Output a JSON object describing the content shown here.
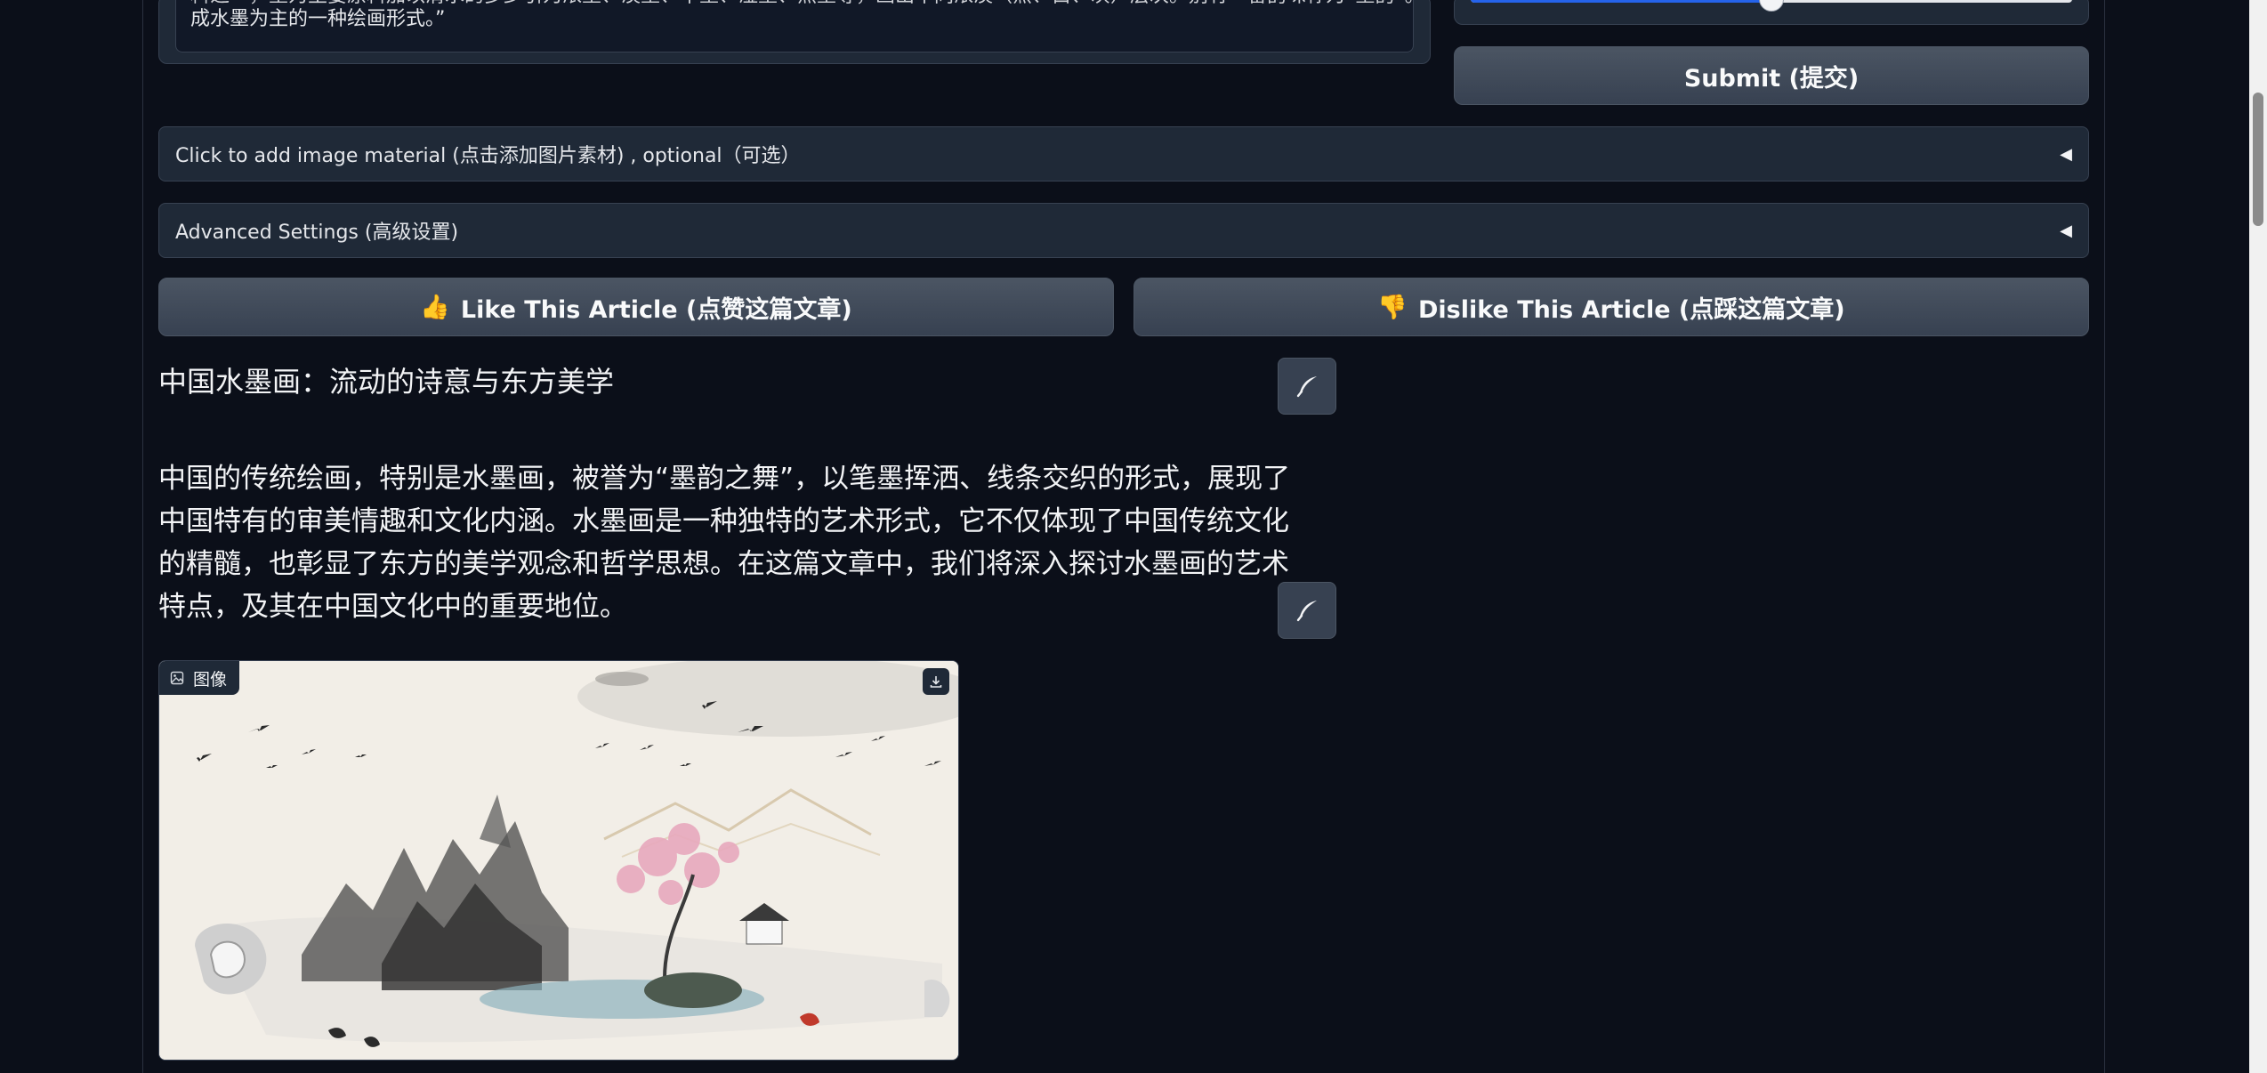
{
  "prompt_text": {
    "line1": "料之一，墨为主要原料加以清水的多少引为浓墨、淡墨、干墨、湿墨、焦墨等，画出不同浓淡（黑、白、灰）层次。别有一番韵味称为“墨韵”。而形",
    "line2": "成水墨为主的一种绘画形式。”"
  },
  "slider": {
    "value_fraction": 0.5
  },
  "submit_label": "Submit (提交)",
  "image_material_label": "Click to add image material (点击添加图片素材) , optional（可选）",
  "advanced_settings_label": "Advanced Settings (高级设置)",
  "accordion_arrow": "◀",
  "like_emoji": "👍",
  "like_label": "Like This Article (点赞这篇文章)",
  "dislike_emoji": "👎",
  "dislike_label": "Dislike This Article (点踩这篇文章)",
  "article": {
    "title": "中国水墨画：流动的诗意与东方美学",
    "paragraph_lines": [
      "中国的传统绘画，特别是水墨画，被誉为“墨韵之舞”，以笔墨挥洒、线条交织的形式，展现了",
      "中国特有的审美情趣和文化内涵。水墨画是一种独特的艺术形式，它不仅体现了中国传统文化",
      "的精髓，也彰显了东方的美学观念和哲学思想。在这篇文章中，我们将深入探讨水墨画的艺术",
      "特点，及其在中国文化中的重要地位。"
    ]
  },
  "image_block": {
    "label": "图像"
  },
  "colors": {
    "background": "#0b0f19",
    "panel": "#1f2937",
    "accent": "#2563eb"
  }
}
